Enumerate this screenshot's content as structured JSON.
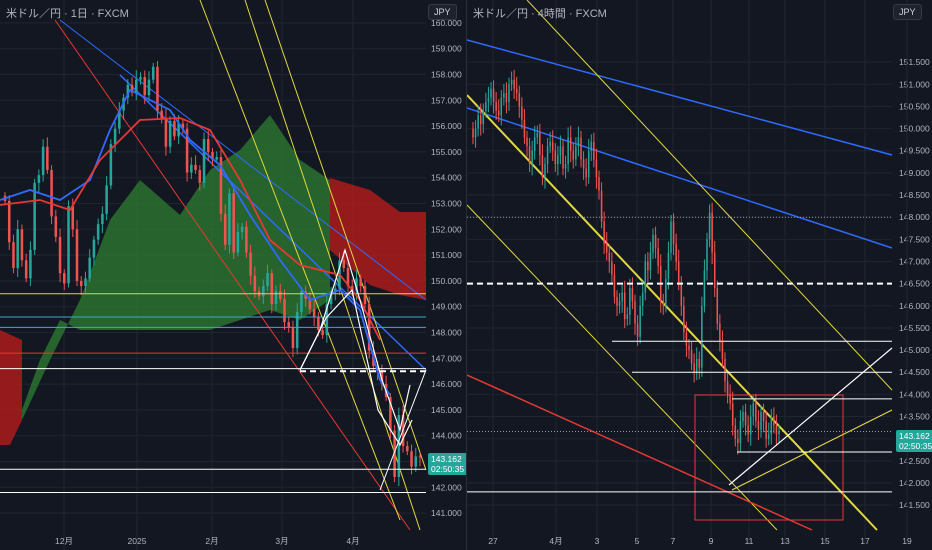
{
  "colors": {
    "bg": "#131722",
    "up": "#26a69a",
    "down": "#ef5350",
    "grid": "#1f2430",
    "axis_text": "#b2b5be",
    "yellow": "#e0d83f",
    "blue": "#2f6bff",
    "red": "#e53935",
    "white": "#ffffff",
    "cloud_green": "#2e7d32",
    "cloud_red": "#b71c1c"
  },
  "left": {
    "title": "米ドル／円 · 1日 · FXCM",
    "currency": "JPY",
    "last_price": "143.162",
    "countdown": "02:50:35"
  },
  "right": {
    "title": "米ドル／円 · 4時間 · FXCM",
    "currency": "JPY",
    "last_price": "143.162",
    "countdown": "02:50:35"
  },
  "chart_data": [
    {
      "type": "candlestick",
      "title": "米ドル／円 · 1日 · FXCM",
      "ylim": [
        140.5,
        160.5
      ],
      "y_ticks": [
        "160.000",
        "159.000",
        "158.000",
        "157.000",
        "156.000",
        "155.000",
        "154.000",
        "153.000",
        "152.000",
        "151.000",
        "150.000",
        "149.000",
        "148.000",
        "147.000",
        "146.000",
        "145.000",
        "144.000",
        "143.000",
        "142.000",
        "141.000"
      ],
      "x_ticks": [
        "12月",
        "2025",
        "2月",
        "3月",
        "4月"
      ],
      "indicators": [
        "ichimoku_cloud",
        "tenkan_sen",
        "kijun_sen"
      ],
      "key_levels": [
        149.5,
        148.6,
        148.2,
        147.2,
        146.6,
        146.5,
        142.7,
        141.8
      ],
      "approx_closes": [
        153.1,
        151.5,
        150.5,
        152.0,
        150.8,
        150.1,
        151.2,
        153.8,
        154.1,
        155.2,
        154.3,
        152.5,
        151.7,
        150.3,
        149.9,
        152.9,
        152.0,
        150.0,
        149.8,
        150.1,
        150.9,
        151.6,
        152.2,
        152.6,
        153.7,
        155.3,
        155.9,
        156.6,
        157.1,
        157.6,
        157.3,
        157.8,
        157.9,
        157.2,
        157.8,
        158.3,
        156.6,
        156.3,
        155.2,
        156.2,
        155.6,
        156.1,
        155.9,
        154.2,
        154.5,
        154.3,
        153.8,
        155.5,
        155.0,
        154.7,
        154.8,
        152.6,
        151.4,
        153.4,
        151.1,
        151.9,
        152.1,
        151.1,
        150.2,
        149.6,
        149.4,
        149.8,
        150.3,
        149.1,
        149.6,
        149.3,
        148.4,
        148.2,
        147.4,
        148.8,
        149.6,
        149.3,
        148.9,
        148.6,
        148.1,
        147.9,
        149.1,
        149.6,
        149.7,
        150.8,
        150.5,
        149.8,
        149.6,
        150.1,
        149.8,
        149.1,
        147.3,
        146.7,
        146.5,
        146.0,
        145.5,
        144.2,
        142.4,
        144.8,
        143.6,
        143.4,
        142.8,
        143.2,
        143.162
      ]
    },
    {
      "type": "candlestick",
      "title": "米ドル／円 · 4時間 · FXCM",
      "ylim": [
        141.3,
        152.0
      ],
      "y_ticks": [
        "151.500",
        "151.000",
        "150.500",
        "150.000",
        "149.500",
        "149.000",
        "148.500",
        "148.000",
        "147.500",
        "147.000",
        "146.500",
        "146.000",
        "145.500",
        "145.000",
        "144.500",
        "144.000",
        "143.500",
        "143.000",
        "142.500",
        "142.000",
        "141.500"
      ],
      "x_ticks": [
        "27",
        "4月",
        "3",
        "5",
        "7",
        "9",
        "11",
        "13",
        "15",
        "17",
        "19",
        "23"
      ],
      "key_levels": [
        148.0,
        146.5,
        145.2,
        144.5,
        143.9,
        143.162,
        142.7,
        141.8
      ],
      "approx_closes": [
        149.8,
        150.0,
        150.3,
        150.1,
        150.4,
        150.6,
        150.7,
        150.9,
        150.6,
        150.4,
        150.3,
        150.7,
        150.8,
        150.6,
        151.0,
        151.1,
        150.9,
        150.8,
        150.5,
        150.2,
        149.8,
        149.6,
        149.2,
        149.5,
        149.8,
        149.9,
        149.4,
        148.9,
        149.2,
        149.6,
        149.7,
        149.5,
        149.2,
        149.4,
        149.6,
        149.1,
        149.2,
        149.8,
        149.5,
        149.3,
        149.6,
        149.8,
        149.3,
        149.1,
        148.9,
        149.5,
        149.7,
        149.3,
        148.9,
        148.6,
        147.9,
        147.4,
        147.2,
        147.0,
        146.7,
        146.2,
        146.0,
        146.1,
        146.3,
        145.7,
        145.8,
        146.4,
        146.1,
        145.6,
        145.3,
        146.0,
        146.3,
        147.0,
        146.8,
        147.2,
        147.6,
        147.3,
        146.9,
        146.1,
        146.0,
        146.6,
        147.2,
        147.9,
        147.4,
        147.0,
        146.5,
        146.0,
        145.4,
        145.1,
        145.0,
        144.7,
        144.5,
        144.8,
        144.6,
        146.0,
        146.8,
        147.5,
        148.1,
        147.2,
        146.4,
        145.6,
        145.2,
        144.8,
        144.3,
        144.0,
        143.8,
        143.3,
        143.0,
        142.9,
        143.4,
        143.6,
        143.3,
        143.1,
        143.5,
        143.8,
        143.4,
        143.2,
        143.6,
        143.4,
        143.0,
        143.1,
        143.5,
        143.3,
        143.1,
        143.162
      ]
    }
  ]
}
